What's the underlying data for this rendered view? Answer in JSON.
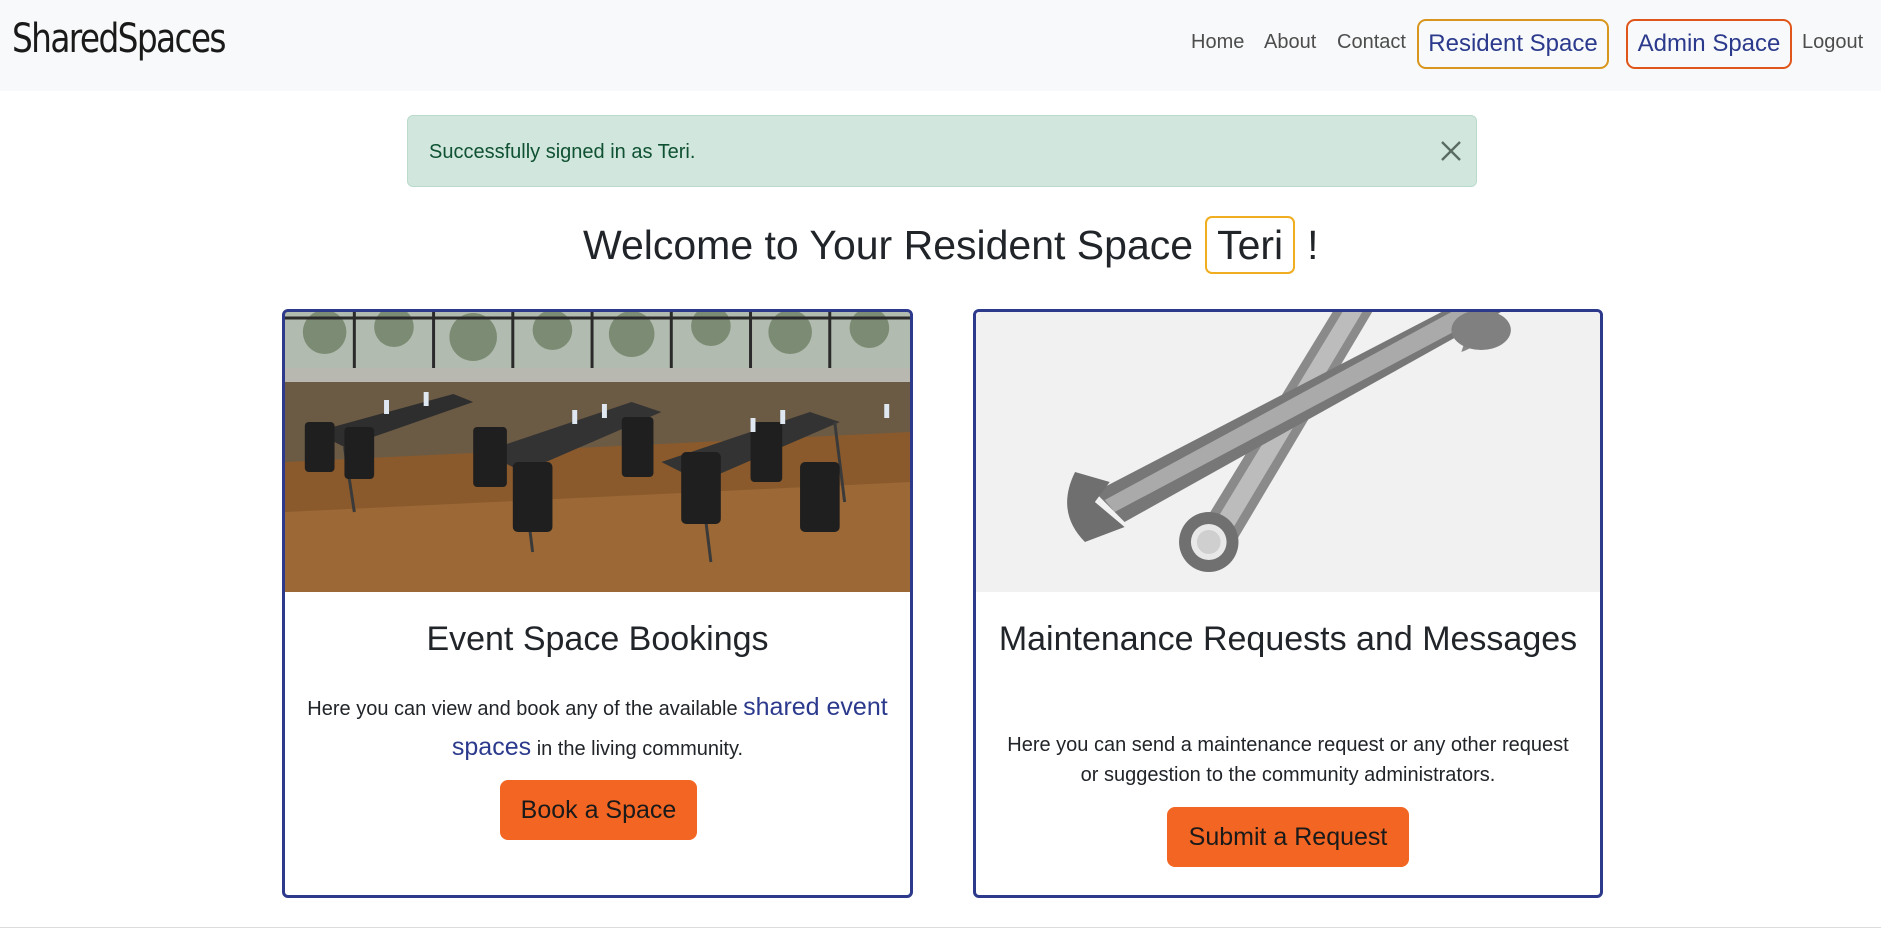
{
  "navbar": {
    "brand": "SharedSpaces",
    "links": [
      "Home",
      "About",
      "Contact"
    ],
    "resident_space": "Resident Space",
    "admin_space": "Admin Space",
    "logout": "Logout",
    "colors": {
      "resident_border": "#d9961f",
      "admin_border": "#e0561a"
    }
  },
  "alert": {
    "message": "Successfully signed in as Teri.",
    "close_icon": "close-icon"
  },
  "welcome": {
    "prefix": "Welcome to Your Resident Space",
    "name": "Teri",
    "suffix": "!"
  },
  "cards": [
    {
      "title": "Event Space Bookings",
      "text_before": "Here you can view and book any of the available",
      "link_text": "shared event spaces",
      "text_after": "in the living community.",
      "button": "Book a Space",
      "image": "conference-room-image"
    },
    {
      "title": "Maintenance Requests and Messages",
      "text": "Here you can send a maintenance request or any other request or suggestion to the community administrators.",
      "button": "Submit a Request",
      "image": "wrenches-image"
    }
  ],
  "theme": {
    "accent": "#f26522",
    "card_border": "#2d3a8c",
    "alert_bg": "#d1e7dd"
  }
}
